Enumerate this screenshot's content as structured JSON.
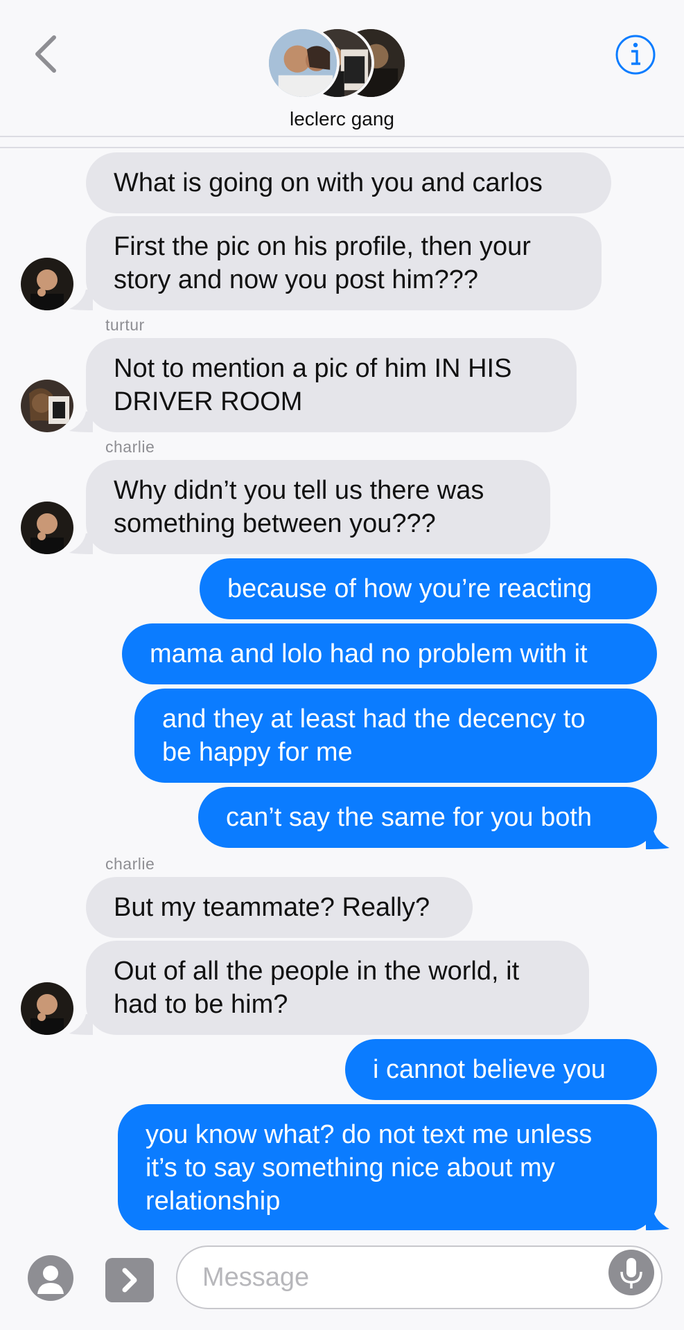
{
  "header": {
    "group_name": "leclerc gang",
    "back_icon": "chevron-left-icon",
    "info_icon": "info-icon",
    "accent": "#0b7cff"
  },
  "messages": [
    {
      "kind": "received",
      "text": [
        "What is going on with you and carlos"
      ]
    },
    {
      "kind": "received",
      "text": [
        "First the pic on his profile, then your",
        "story and now you post him???"
      ]
    },
    {
      "kind": "sender",
      "text": "turtur"
    },
    {
      "kind": "received",
      "text": [
        "Not to mention a pic of him IN HIS",
        "DRIVER ROOM"
      ]
    },
    {
      "kind": "sender",
      "text": "charlie"
    },
    {
      "kind": "received",
      "text": [
        "Why didn’t you tell us there was",
        "something between you???"
      ]
    },
    {
      "kind": "sent",
      "text": [
        "because of how you’re reacting"
      ]
    },
    {
      "kind": "sent",
      "text": [
        "mama and lolo had no problem with it"
      ]
    },
    {
      "kind": "sent",
      "text": [
        "and they at least had the decency to",
        "be happy for me"
      ]
    },
    {
      "kind": "sent",
      "text": [
        "can’t say the same for you both"
      ]
    },
    {
      "kind": "sender",
      "text": "charlie"
    },
    {
      "kind": "received",
      "text": [
        "But my teammate? Really?"
      ]
    },
    {
      "kind": "received",
      "text": [
        "Out of all the people in the world, it",
        "had to be him?"
      ]
    },
    {
      "kind": "sent",
      "text": [
        "i cannot believe you"
      ]
    },
    {
      "kind": "sent",
      "text": [
        "you know what? do not text me unless",
        "it’s to say something nice about my",
        "relationship"
      ]
    }
  ],
  "composer": {
    "placeholder": "Message",
    "camera_icon": "camera-icon",
    "apps_icon": "chevron-right-icon",
    "mic_icon": "microphone-icon"
  },
  "colors": {
    "received_bubble": "#e5e5ea",
    "sent_bubble": "#0b7cff",
    "sender_name": "#8e8e93"
  }
}
